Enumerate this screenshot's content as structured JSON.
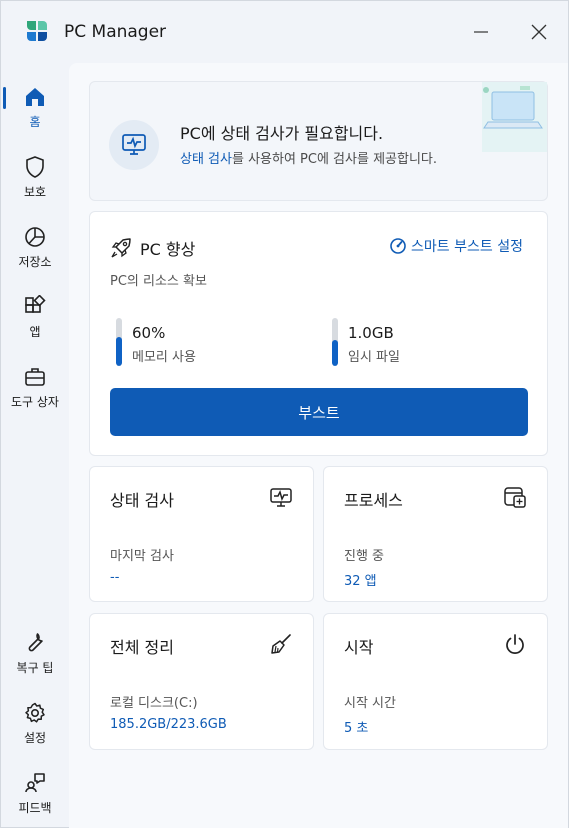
{
  "app": {
    "title": "PC Manager"
  },
  "sidebar": {
    "items": [
      {
        "label": "홈",
        "icon": "home-icon"
      },
      {
        "label": "보호",
        "icon": "shield-icon"
      },
      {
        "label": "저장소",
        "icon": "pie-chart-icon"
      },
      {
        "label": "앱",
        "icon": "apps-icon"
      },
      {
        "label": "도구 상자",
        "icon": "toolbox-icon"
      }
    ],
    "bottom_items": [
      {
        "label": "복구 팁",
        "icon": "wrench-icon"
      },
      {
        "label": "설정",
        "icon": "gear-icon"
      },
      {
        "label": "피드백",
        "icon": "feedback-icon"
      }
    ]
  },
  "banner": {
    "title": "PC에 상태 검사가 필요합니다.",
    "subtitle_link": "상태 검사",
    "subtitle_rest": "를 사용하여 PC에 검사를 제공합니다."
  },
  "boost": {
    "title": "PC 향상",
    "subtitle": "PC의 리소스 확보",
    "smart_link": "스마트 부스트 설정",
    "memory": {
      "value": "60%",
      "label": "메모리 사용",
      "level": 0.6
    },
    "temp": {
      "value": "1.0GB",
      "label": "임시 파일",
      "level": 0.55
    },
    "button": "부스트"
  },
  "tiles": [
    {
      "title": "상태 검사",
      "label": "마지막 검사",
      "value": "--",
      "icon": "health-monitor-icon"
    },
    {
      "title": "프로세스",
      "label": "진행 중",
      "value": "32 앱",
      "icon": "process-icon"
    },
    {
      "title": "전체 정리",
      "label": "로컬 디스크(C:)",
      "value": "185.2GB/223.6GB",
      "icon": "broom-icon"
    },
    {
      "title": "시작",
      "label": "시작 시간",
      "value": "5 초",
      "icon": "power-icon"
    }
  ],
  "colors": {
    "accent": "#0f5bb5",
    "background": "#f1f4f9",
    "card": "#ffffff"
  }
}
